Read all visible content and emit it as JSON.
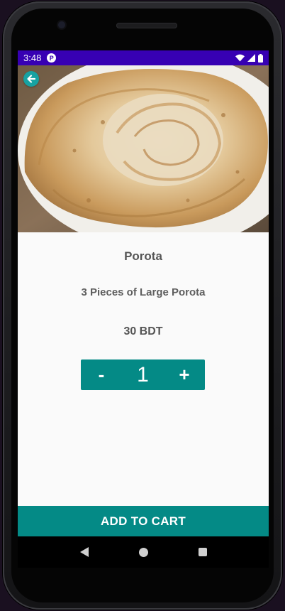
{
  "status": {
    "time": "3:48",
    "app_badge": "P"
  },
  "product": {
    "name": "Porota",
    "description": "3 Pieces of Large Porota",
    "price": "30 BDT"
  },
  "quantity": {
    "minus_label": "-",
    "value": "1",
    "plus_label": "+"
  },
  "actions": {
    "add_to_cart": "ADD TO CART"
  },
  "colors": {
    "status_bar": "#3700b3",
    "accent": "#048a86",
    "back_button": "#17a2a2"
  },
  "icons": {
    "back": "arrow-left-icon",
    "wifi": "wifi-icon",
    "signal": "signal-icon",
    "battery": "battery-icon"
  }
}
